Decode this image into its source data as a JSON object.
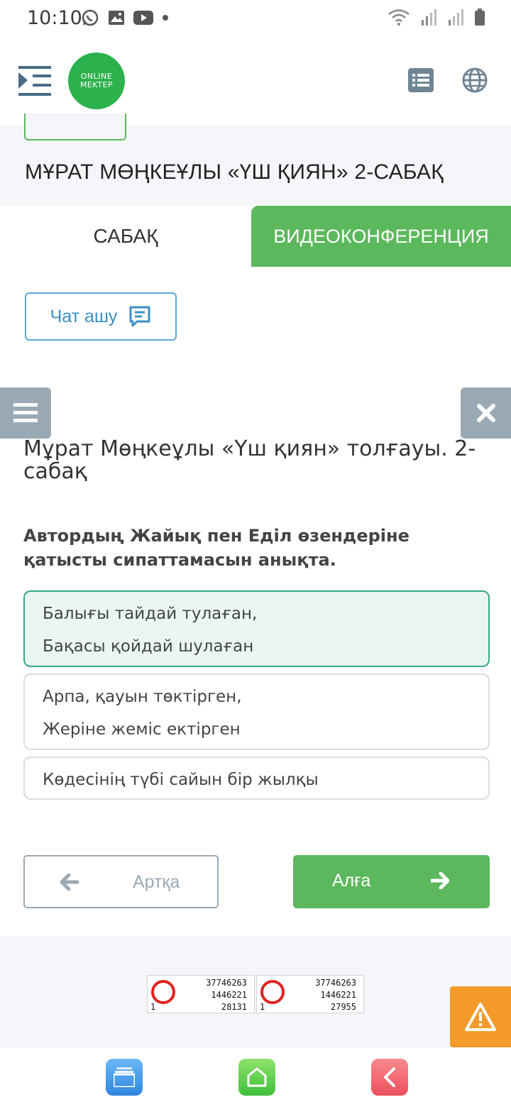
{
  "status_bar": {
    "time": "10:10",
    "left_icons": [
      "whatsapp-icon",
      "gallery-icon",
      "youtube-icon",
      "dot-icon"
    ],
    "right_icons": [
      "wifi-icon",
      "signal-icon",
      "signal-icon",
      "battery-icon"
    ]
  },
  "header": {
    "logo_line1": "ONLINE",
    "logo_line2": "MEKTEP",
    "brand_color": "#2bb24c"
  },
  "lesson": {
    "title": "МҰРАТ МӨҢКЕҰЛЫ «ҮШ ҚИЯН» 2-САБАҚ"
  },
  "tabs": [
    {
      "label": "САБАҚ",
      "active": true
    },
    {
      "label": "ВИДЕОКОНФЕРЕНЦИЯ",
      "active": false
    }
  ],
  "chat": {
    "label": "Чат ашу"
  },
  "content": {
    "topic_title": "Мұрат Мөңкеұлы «Үш қиян» толғауы. 2-сабақ",
    "question": "Автордың Жайық пен Еділ өзендеріне қатысты сипаттамасын анықта.",
    "options": [
      {
        "lines": [
          "Балығы тайдай тулаған,",
          "Бақасы қойдай шулаған"
        ],
        "selected": true
      },
      {
        "lines": [
          "Арпа, қауын төктірген,",
          "Жеріне жеміс ектірген"
        ],
        "selected": false
      },
      {
        "lines": [
          "Көдесінің түбі сайын бір жылқы"
        ],
        "selected": false
      }
    ]
  },
  "navigation": {
    "back_label": "Артқа",
    "next_label": "Алға"
  },
  "counters": [
    {
      "total": "37746263",
      "month": "1446221",
      "day": "28131",
      "online": "1"
    },
    {
      "total": "37746263",
      "month": "1446221",
      "day": "27955",
      "online": "1"
    }
  ],
  "colors": {
    "accent_green": "#5cb85c",
    "chat_blue": "#3b8fc5",
    "side_grey": "#9aa9b4",
    "warning_orange": "#f39a2b"
  }
}
